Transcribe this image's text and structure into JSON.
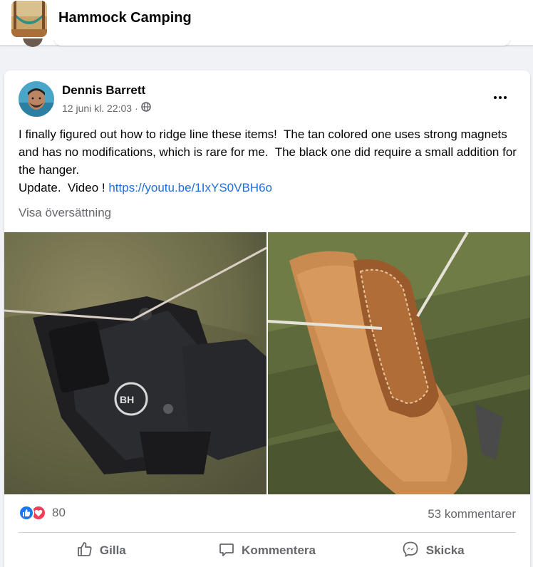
{
  "group": {
    "name": "Hammock Camping",
    "thumb_icon": "group-photo-hammock"
  },
  "post": {
    "author": "Dennis Barrett",
    "timestamp": "12 juni kl. 22:03",
    "separator": "·",
    "audience_icon": "globe-icon",
    "text_lines": [
      "I finally figured out how to ridge line these items!  The tan colored one uses strong magnets and has no modifications, which is rare for me.  The black one did require a small addition for the hanger.",
      "Update.  Video ! "
    ],
    "link": "https://youtu.be/1IxYS0VBH6o",
    "translate_label": "Visa översättning"
  },
  "footer": {
    "reaction_count": "80",
    "comments_label": "53 kommentarer",
    "actions": {
      "like": "Gilla",
      "comment": "Kommentera",
      "share": "Skicka"
    }
  },
  "colors": {
    "link": "#216fdb",
    "like": "#1877f2",
    "love": "#f33e58",
    "muted": "#65676b"
  }
}
